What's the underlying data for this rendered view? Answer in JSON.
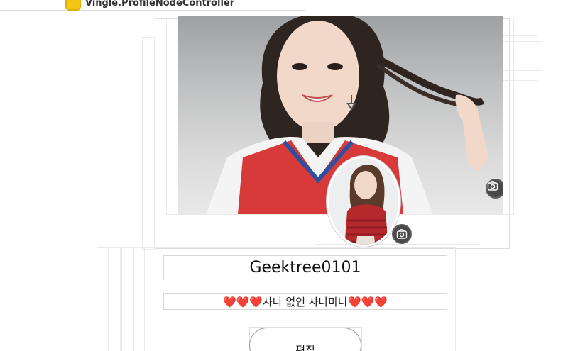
{
  "controller": {
    "label": "Vingle.ProfileNodeController",
    "icon": "controller-icon"
  },
  "cover": {
    "camera_icon": "camera-icon"
  },
  "avatar": {
    "camera_icon": "camera-icon"
  },
  "profile": {
    "username": "Geektree0101",
    "bio": "❤️❤️❤️사나 없인 사나마나❤️❤️❤️"
  },
  "actions": {
    "edit_label": "편집"
  },
  "colors": {
    "camera_bg": "#4a4a4a",
    "controller_icon": "#f5c518"
  }
}
